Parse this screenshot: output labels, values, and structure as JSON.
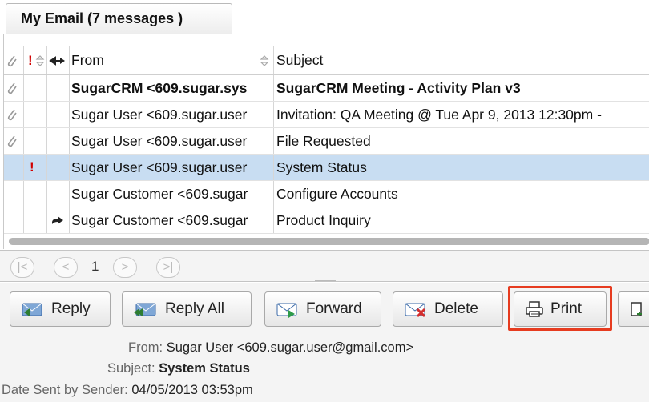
{
  "tab": {
    "title": "My Email (7 messages )"
  },
  "grid": {
    "columns": {
      "from": "From",
      "subject": "Subject"
    },
    "rows": [
      {
        "from": "SugarCRM <609.sugar.sys",
        "subject": "SugarCRM Meeting - Activity Plan v3",
        "attachment": true,
        "important": false,
        "forwarded": false,
        "unread": true,
        "selected": false
      },
      {
        "from": "Sugar User <609.sugar.user",
        "subject": "Invitation: QA Meeting @ Tue Apr 9, 2013 12:30pm -",
        "attachment": true,
        "important": false,
        "forwarded": false,
        "unread": false,
        "selected": false
      },
      {
        "from": "Sugar User <609.sugar.user",
        "subject": "File Requested",
        "attachment": true,
        "important": false,
        "forwarded": false,
        "unread": false,
        "selected": false
      },
      {
        "from": "Sugar User <609.sugar.user",
        "subject": "System Status",
        "attachment": false,
        "important": true,
        "forwarded": false,
        "unread": false,
        "selected": true
      },
      {
        "from": "Sugar Customer <609.sugar",
        "subject": "Configure Accounts",
        "attachment": false,
        "important": false,
        "forwarded": false,
        "unread": false,
        "selected": false
      },
      {
        "from": "Sugar Customer <609.sugar",
        "subject": "Product Inquiry",
        "attachment": false,
        "important": false,
        "forwarded": true,
        "unread": false,
        "selected": false
      }
    ]
  },
  "pager": {
    "page": "1"
  },
  "toolbar": {
    "reply": "Reply",
    "reply_all": "Reply All",
    "forward": "Forward",
    "delete": "Delete",
    "print": "Print"
  },
  "detail": {
    "from_label": "From:",
    "from_value": "Sugar User <609.sugar.user@gmail.com>",
    "subject_label": "Subject:",
    "subject_value": "System Status",
    "date_label": "Date Sent by Sender:",
    "date_value": "04/05/2013 03:53pm"
  },
  "colors": {
    "selected_row": "#c8ddf2",
    "highlight": "#e63b1f",
    "important": "#d10000"
  }
}
